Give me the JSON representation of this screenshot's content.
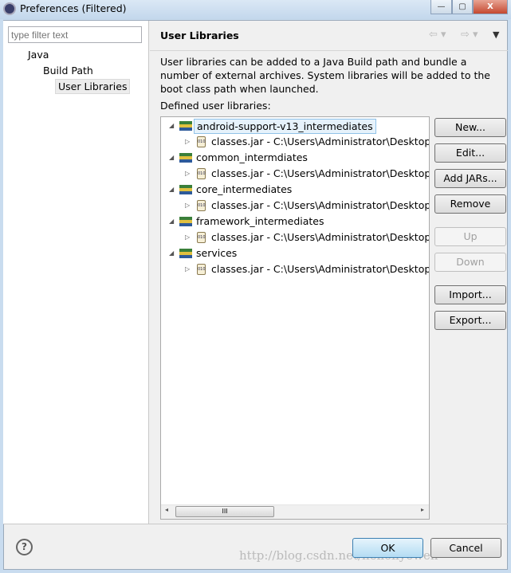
{
  "window": {
    "title": "Preferences (Filtered)",
    "min": "—",
    "max": "▢",
    "close": "X"
  },
  "filter": {
    "placeholder": "type filter text"
  },
  "nav": [
    "Java",
    "Build Path",
    "User Libraries"
  ],
  "page": {
    "title": "User Libraries",
    "description": "User libraries can be added to a Java Build path and bundle a number of external archives. System libraries will be added to the boot class path when launched.",
    "defined_label": "Defined user libraries:"
  },
  "libraries": [
    {
      "name": "android-support-v13_intermediates",
      "jar": "classes.jar - C:\\Users\\Administrator\\Desktop\\la"
    },
    {
      "name": "common_intermdiates",
      "jar": "classes.jar - C:\\Users\\Administrator\\Desktop\\la"
    },
    {
      "name": "core_intermediates",
      "jar": "classes.jar - C:\\Users\\Administrator\\Desktop\\la"
    },
    {
      "name": "framework_intermediates",
      "jar": "classes.jar - C:\\Users\\Administrator\\Desktop\\la"
    },
    {
      "name": "services",
      "jar": "classes.jar - C:\\Users\\Administrator\\Desktop\\la"
    }
  ],
  "buttons": {
    "new": "New...",
    "edit": "Edit...",
    "add_jars": "Add JARs...",
    "remove": "Remove",
    "up": "Up",
    "down": "Down",
    "import": "Import...",
    "export": "Export..."
  },
  "scroll_thumb": "III",
  "dialog": {
    "ok": "OK",
    "cancel": "Cancel",
    "help": "?"
  },
  "watermark": "http://blog.csdn.net/helloliyewen"
}
